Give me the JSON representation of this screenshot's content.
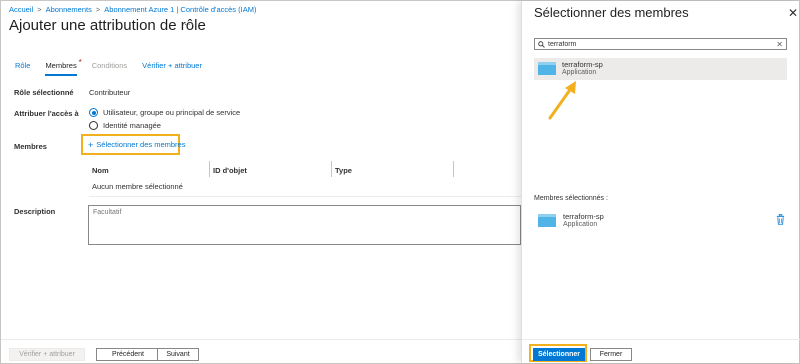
{
  "breadcrumb": {
    "items": [
      "Accueil",
      "Abonnements",
      "Abonnement Azure 1 | Contrôle d'accès (IAM)"
    ],
    "separator": ">"
  },
  "page": {
    "title": "Ajouter une attribution de rôle",
    "more": "···"
  },
  "tabs": [
    {
      "label": "Rôle",
      "state": "normal"
    },
    {
      "label": "Membres",
      "state": "active",
      "required_marker": "*"
    },
    {
      "label": "Conditions",
      "state": "disabled"
    },
    {
      "label": "Vérifier + attribuer",
      "state": "normal"
    }
  ],
  "form": {
    "role_label": "Rôle sélectionné",
    "role_value": "Contributeur",
    "assign_label": "Attribuer l'accès à",
    "assign_options": [
      {
        "label": "Utilisateur, groupe ou principal de service",
        "checked": true
      },
      {
        "label": "Identité managée",
        "checked": false
      }
    ],
    "members_label": "Membres",
    "select_members_link": "Sélectionner des membres",
    "select_members_icon": "+",
    "grid_columns": [
      "Nom",
      "ID d'objet",
      "Type"
    ],
    "grid_empty": "Aucun membre sélectionné",
    "description_label": "Description",
    "description_placeholder": "Facultatif"
  },
  "footer": {
    "review_assign": "Vérifier + attribuer",
    "previous": "Précédent",
    "next": "Suivant"
  },
  "panel": {
    "title": "Sélectionner des membres",
    "close": "✕",
    "search_value": "terraform",
    "search_clear": "✕",
    "results": [
      {
        "name": "terraform-sp",
        "type": "Application"
      }
    ],
    "selected_label": "Membres sélectionnés :",
    "selected": [
      {
        "name": "terraform-sp",
        "type": "Application"
      }
    ],
    "select_button": "Sélectionner",
    "close_button": "Fermer"
  },
  "colors": {
    "accent": "#0078d4",
    "highlight": "#f2b01e",
    "app_icon": "#50b4e6"
  }
}
